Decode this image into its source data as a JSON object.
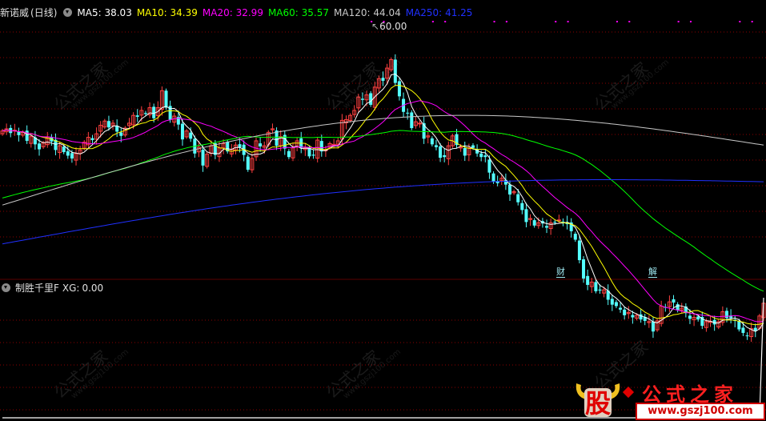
{
  "header": {
    "stock_name": "新诺威",
    "period": "(日线)",
    "ma5_label": "MA5:",
    "ma5_value": "38.03",
    "ma10_label": "MA10:",
    "ma10_value": "34.39",
    "ma20_label": "MA20:",
    "ma20_value": "32.99",
    "ma60_label": "MA60:",
    "ma60_value": "35.57",
    "ma120_label": "MA120:",
    "ma120_value": "44.04",
    "ma250_label": "MA250:",
    "ma250_value": "41.25"
  },
  "indicator": {
    "name": "制胜千里F",
    "xg_label": "XG:",
    "xg_value": "0.00"
  },
  "markers": {
    "max_price": "60.00",
    "tag_cai": "财",
    "tag_jie": "解"
  },
  "watermark": {
    "text": "公式之家",
    "url": "www.gszj100.com",
    "logo_char": "股",
    "logo_text": "公式之家",
    "logo_url": "www.gszj100.com"
  },
  "colors": {
    "up": "#ff4040",
    "down": "#54ffff",
    "ma5": "#ffffff",
    "ma10": "#ffff00",
    "ma20": "#ff00ff",
    "ma60": "#00ff00",
    "ma120": "#c8c8c8",
    "ma250": "#2030ff",
    "grid": "#8b0000",
    "indicator": "#ffffff"
  },
  "chart_data": {
    "type": "candlestick",
    "timeframe": "daily",
    "price_range": [
      28,
      62
    ],
    "max_label": 60.0,
    "ma_latest": {
      "MA5": 38.03,
      "MA10": 34.39,
      "MA20": 32.99,
      "MA60": 35.57,
      "MA120": 44.04,
      "MA250": 41.25
    },
    "closes": [
      45.5,
      45.8,
      45.2,
      45.6,
      44.9,
      45.3,
      44.1,
      44.7,
      43.6,
      42.9,
      43.8,
      44.6,
      44.0,
      42.8,
      43.4,
      42.5,
      42.0,
      41.6,
      42.3,
      42.8,
      43.9,
      44.6,
      44.2,
      45.1,
      46.3,
      46.9,
      46.0,
      46.6,
      45.4,
      44.8,
      45.9,
      46.6,
      47.7,
      47.5,
      48.4,
      47.9,
      48.8,
      47.3,
      48.8,
      51.2,
      48.8,
      47.1,
      47.6,
      46.4,
      44.3,
      45.5,
      44.4,
      42.3,
      43.2,
      40.6,
      42.2,
      43.4,
      42.1,
      43.1,
      43.7,
      42.6,
      42.9,
      43.5,
      43.2,
      42.1,
      40.0,
      41.6,
      44.1,
      43.3,
      43.4,
      45.3,
      45.8,
      43.4,
      44.7,
      43.0,
      41.8,
      43.1,
      44.1,
      43.1,
      43.1,
      41.9,
      42.0,
      44.2,
      42.6,
      42.8,
      43.7,
      43.6,
      44.1,
      47.0,
      47.1,
      47.7,
      48.4,
      50.3,
      49.9,
      50.6,
      49.2,
      51.7,
      52.9,
      52.6,
      54.4,
      55.6,
      52.3,
      50.4,
      48.2,
      48.0,
      45.9,
      46.8,
      46.6,
      44.4,
      44.8,
      43.6,
      43.2,
      41.7,
      41.8,
      43.4,
      44.8,
      43.5,
      43.2,
      42.0,
      43.1,
      43.1,
      42.3,
      41.8,
      41.8,
      39.6,
      38.3,
      38.1,
      38.8,
      37.9,
      36.5,
      36.9,
      35.4,
      34.3,
      32.6,
      33.1,
      32.1,
      32.5,
      32.4,
      31.8,
      32.5,
      32.5,
      32.9,
      32.6,
      32.3,
      31.3,
      30.1,
      27.2,
      24.6,
      23.7,
      24.1,
      22.8,
      22.9,
      23.0,
      21.6,
      20.9,
      20.7,
      20.2,
      19.4,
      19.8,
      19.1,
      19.4,
      18.8,
      18.6,
      18.5,
      17.1,
      18.6,
      20.7,
      20.5,
      21.3,
      21.2,
      20.1,
      20.4,
      19.7,
      18.9,
      19.1,
      18.8,
      17.9,
      18.5,
      18.5,
      18.1,
      18.5,
      19.9,
      19.0,
      19.0,
      18.6,
      17.4,
      16.9,
      16.5,
      17.5,
      17.2,
      19.3,
      21.1
    ],
    "indicator_series": {
      "name": "XG",
      "latest": 0.0,
      "spike_index": 186,
      "spike_value": 1.0
    }
  }
}
